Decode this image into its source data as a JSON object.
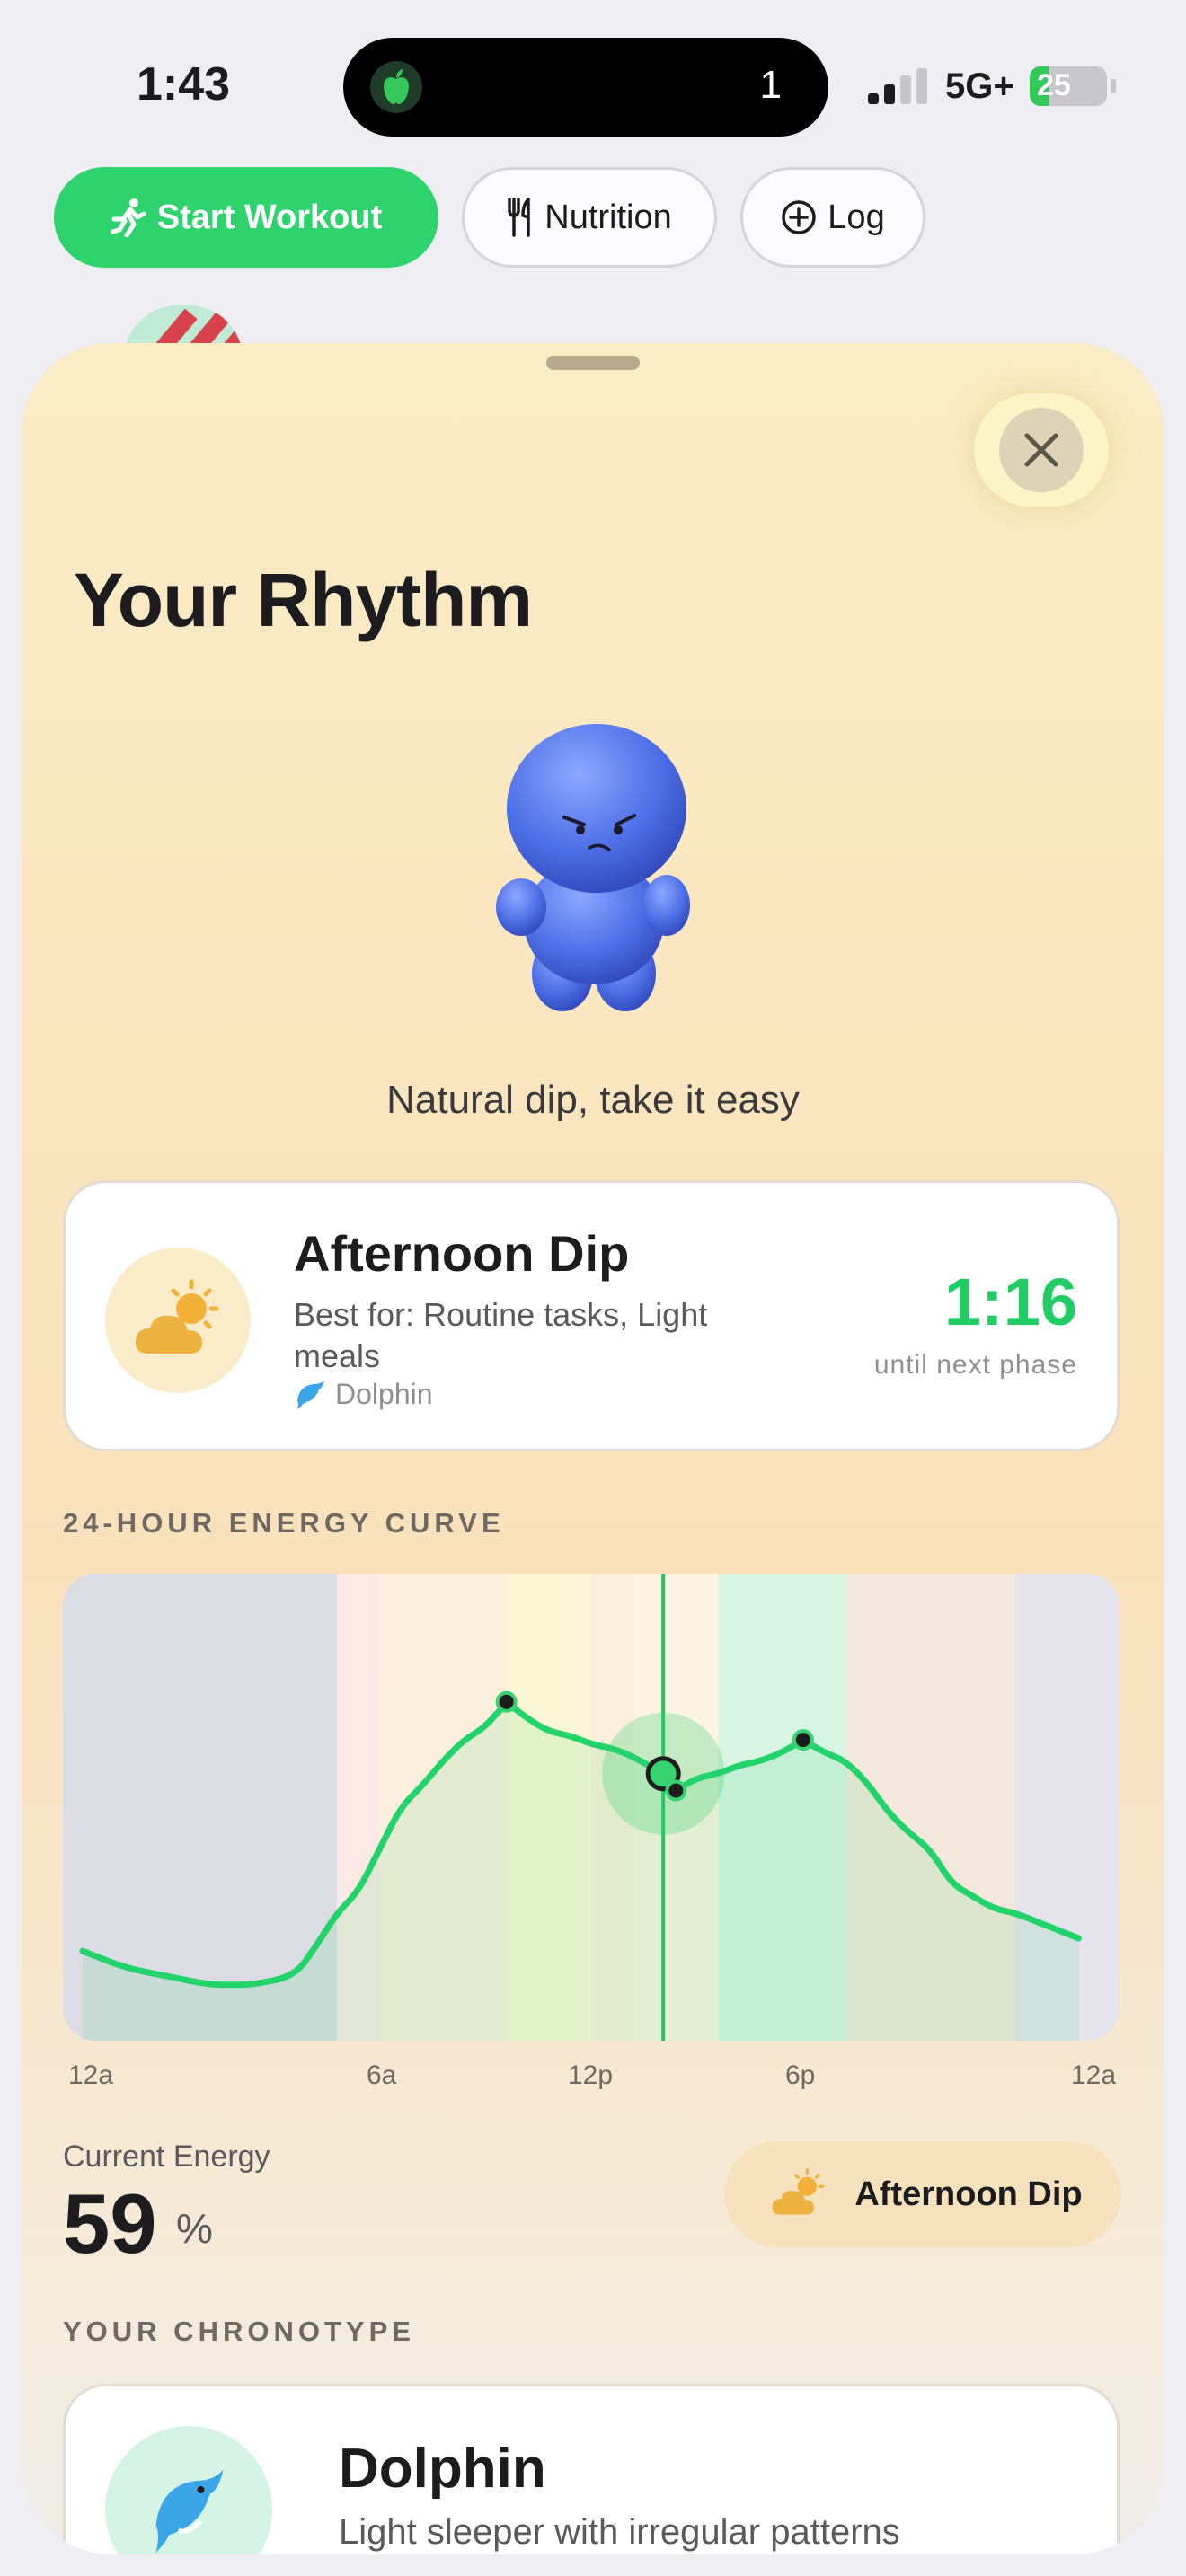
{
  "status_bar": {
    "time": "1:43",
    "activity_count": "1",
    "network": "5G+",
    "battery": "25",
    "battery_level": 0.25
  },
  "quick_actions": {
    "start_workout": "Start Workout",
    "nutrition": "Nutrition",
    "log": "Log"
  },
  "sheet": {
    "title": "Your Rhythm",
    "mascot_message": "Natural dip, take it easy",
    "current_phase": {
      "name": "Afternoon Dip",
      "best_for": "Best for: Routine tasks, Light meals",
      "chronotype": "Dolphin",
      "time_remaining": "1:16",
      "time_remaining_label": "until next phase"
    },
    "energy_section_label": "24-HOUR ENERGY CURVE",
    "x_labels": [
      "12a",
      "6a",
      "12p",
      "6p",
      "12a"
    ],
    "current_energy_label": "Current Energy",
    "current_energy_value": "59",
    "current_energy_unit": "%",
    "phase_chip": "Afternoon Dip",
    "chronotype_section_label": "YOUR CHRONOTYPE",
    "chronotype": {
      "name": "Dolphin",
      "description": "Light sleeper with irregular patterns"
    }
  },
  "colors": {
    "accent": "#2ed36e",
    "curve": "#22d36a",
    "sheet_top": "#faecc5"
  },
  "chart_data": {
    "type": "line",
    "x_domain": [
      0,
      24
    ],
    "ylim": [
      0,
      100
    ],
    "x_ticks": [
      "12a",
      "6a",
      "12p",
      "6p",
      "12a"
    ],
    "current_time_hour": 13.7,
    "series": [
      {
        "x": [
          0,
          1,
          2,
          3,
          3.5,
          4,
          5,
          5.5,
          6,
          6.5,
          7,
          7.5,
          8,
          8.5,
          9,
          9.5,
          10,
          10.5,
          11,
          11.5,
          12,
          12.5,
          13,
          13.7,
          14,
          14.5,
          15,
          15.5,
          16,
          16.5,
          17,
          17.5,
          18,
          18.5,
          19,
          19.5,
          20,
          20.5,
          21,
          21.5,
          22,
          22.5,
          23,
          23.5
        ],
        "y": [
          17,
          13,
          11,
          9,
          9,
          9,
          11,
          18,
          26,
          31,
          41,
          51,
          56,
          62,
          67,
          70,
          76,
          72,
          69,
          68,
          66,
          65,
          63,
          59,
          55,
          58,
          59,
          61,
          62,
          64,
          67,
          64,
          62,
          57,
          50,
          45,
          41,
          33,
          30,
          27,
          26,
          24,
          22,
          20
        ]
      }
    ],
    "markers": [
      {
        "x": 10,
        "y": 76
      },
      {
        "x": 14,
        "y": 55
      },
      {
        "x": 17,
        "y": 67
      }
    ],
    "phase_bands": [
      {
        "from": 0,
        "to": 6,
        "color": "#dcdce4"
      },
      {
        "from": 6,
        "to": 7,
        "color": "#fbe9e6"
      },
      {
        "from": 7,
        "to": 10,
        "color": "#fcefde"
      },
      {
        "from": 10,
        "to": 12,
        "color": "#fcf7d6"
      },
      {
        "from": 12,
        "to": 13,
        "color": "#fbeedc"
      },
      {
        "from": 13,
        "to": 15,
        "color": "#fcf3e2"
      },
      {
        "from": 15,
        "to": 18,
        "color": "#d8f4e3"
      },
      {
        "from": 18,
        "to": 22,
        "color": "#f4e8dc"
      },
      {
        "from": 22,
        "to": 24,
        "color": "#e5e3ec"
      }
    ]
  },
  "icons": {
    "activity": "apple-icon",
    "workout": "running-figure-icon",
    "nutrition": "fork-knife-icon",
    "log": "plus-circle-icon",
    "close": "close-icon",
    "phase": "sun-behind-cloud-icon",
    "chronotype": "dolphin-icon"
  }
}
